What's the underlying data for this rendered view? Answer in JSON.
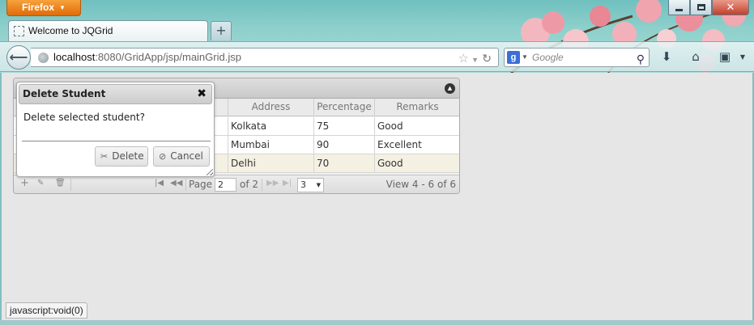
{
  "browser": {
    "menu_label": "Firefox",
    "tab_title": "Welcome to JQGrid",
    "new_tab_symbol": "+",
    "url_host": "localhost",
    "url_path": ":8080/GridApp/jsp/mainGrid.jsp",
    "search_placeholder": "Google",
    "status_text": "javascript:void(0)"
  },
  "grid": {
    "headers": [
      "Address",
      "Percentage",
      "Remarks"
    ],
    "rows": [
      {
        "address": "Kolkata",
        "percentage": "75",
        "remarks": "Good",
        "selected": false
      },
      {
        "address": "Mumbai",
        "percentage": "90",
        "remarks": "Excellent",
        "selected": false
      },
      {
        "address": "Delhi",
        "percentage": "70",
        "remarks": "Good",
        "selected": true
      }
    ],
    "pager": {
      "page_label": "Page",
      "page_value": "2",
      "of_label": "of 2",
      "rows_per_page": "3",
      "view_info": "View 4 - 6 of 6"
    }
  },
  "dialog": {
    "title": "Delete Student",
    "close_symbol": "✖",
    "message": "Delete selected student?",
    "delete_label": "Delete",
    "cancel_label": "Cancel"
  },
  "icons": {
    "add": "add-icon",
    "edit": "edit-icon",
    "trash": "trash-icon",
    "scissors": "scissors-icon",
    "cancel": "cancel-icon"
  }
}
